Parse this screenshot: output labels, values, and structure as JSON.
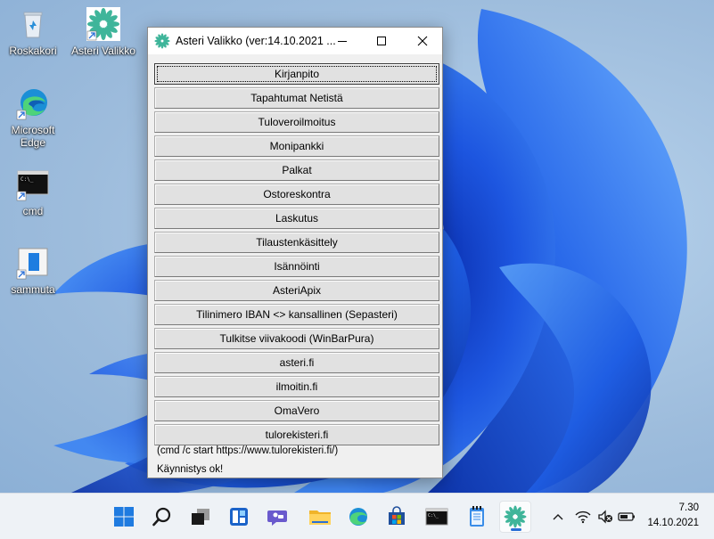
{
  "desktop": {
    "icons": [
      {
        "label": "Roskakori"
      },
      {
        "label": "Asteri Valikko"
      },
      {
        "label": "Microsoft Edge"
      },
      {
        "label": "cmd"
      },
      {
        "label": "sammuta"
      }
    ]
  },
  "window": {
    "title": "Asteri Valikko (ver:14.10.2021 ...",
    "buttons": [
      {
        "label": "Kirjanpito"
      },
      {
        "label": "Tapahtumat Netistä"
      },
      {
        "label": "Tuloveroilmoitus"
      },
      {
        "label": "Monipankki"
      },
      {
        "label": "Palkat"
      },
      {
        "label": "Ostoreskontra"
      },
      {
        "label": "Laskutus"
      },
      {
        "label": "Tilaustenkäsittely"
      },
      {
        "label": "Isännöinti"
      },
      {
        "label": "AsteriApix"
      },
      {
        "label": "Tilinimero IBAN <> kansallinen (Sepasteri)"
      },
      {
        "label": "Tulkitse viivakoodi (WinBarPura)"
      },
      {
        "label": "asteri.fi"
      },
      {
        "label": "ilmoitin.fi"
      },
      {
        "label": "OmaVero"
      },
      {
        "label": "tulorekisteri.fi"
      }
    ],
    "command_text": "(cmd /c start https://www.tulorekisteri.fi/)",
    "status_text": "Käynnistys ok!"
  },
  "taskbar": {
    "icons": [
      "start-icon",
      "search-icon",
      "task-view-icon",
      "widgets-icon",
      "chat-icon",
      "file-explorer-icon",
      "edge-icon",
      "store-icon",
      "cmd-icon",
      "notepad-icon",
      "asteri-icon"
    ],
    "tray_icons": [
      "chevron-up-icon",
      "wifi-icon",
      "volume-muted-icon",
      "battery-icon"
    ],
    "time": "7.30",
    "date": "14.10.2021"
  },
  "colors": {
    "accent": "#2a6fd6",
    "bloom": "#1a4fd0",
    "asteri_green": "#3fb59a"
  }
}
